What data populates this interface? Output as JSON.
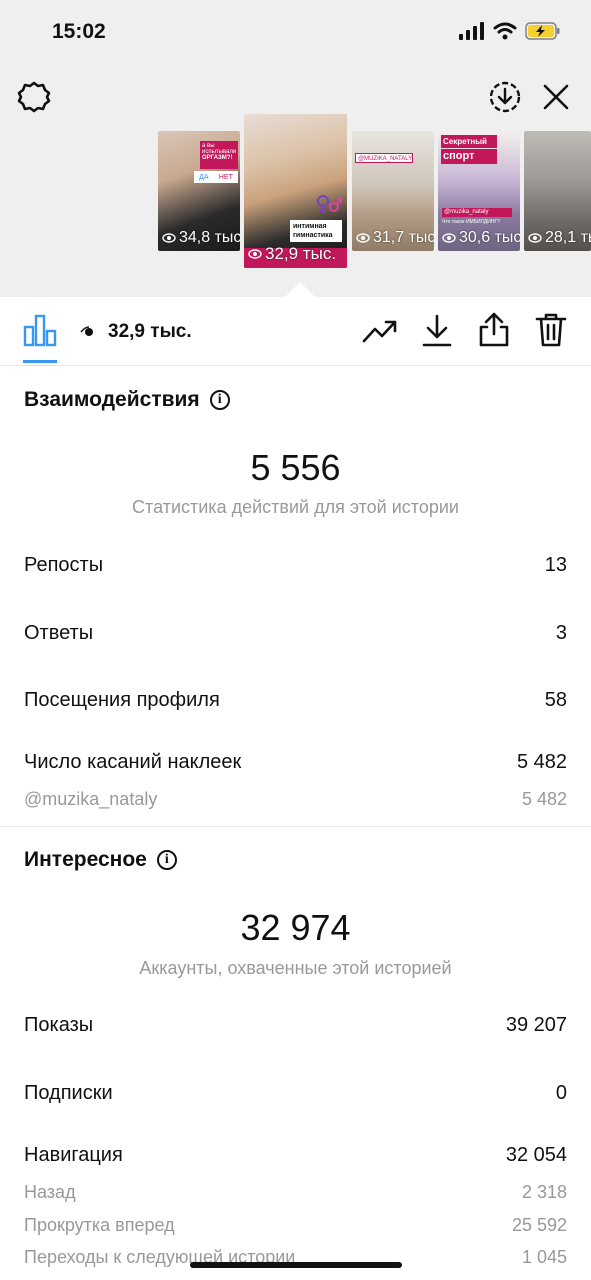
{
  "status_bar": {
    "time": "15:02"
  },
  "stories": [
    {
      "views": "34,8 тыс.",
      "sticker_lines": [
        "а вы испытывали",
        "ОРГАЗМ?!"
      ],
      "poll_options": [
        "ДА",
        "НЕТ"
      ]
    },
    {
      "views": "32,9 тыс.",
      "sticker_lines": [
        "интимная",
        "гимнастика"
      ],
      "selected": true
    },
    {
      "views": "31,7 тыс.",
      "sticker_lines": [
        "@MUZIKA_NATALY"
      ]
    },
    {
      "views": "30,6 тыс.",
      "sticker_lines": [
        "Секретный",
        "спорт",
        "@muzika_nataly",
        "Что такое ИМБИЛДИНГ?"
      ]
    },
    {
      "views": "28,1 тыс."
    }
  ],
  "toolbar": {
    "views": "32,9 тыс."
  },
  "interactions": {
    "title": "Взаимодействия",
    "total": "5 556",
    "subtitle": "Статистика действий для этой истории",
    "rows": [
      {
        "label": "Репосты",
        "value": "13"
      },
      {
        "label": "Ответы",
        "value": "3"
      },
      {
        "label": "Посещения профиля",
        "value": "58"
      },
      {
        "label": "Число касаний наклеек",
        "value": "5 482"
      }
    ],
    "sticker_sub": {
      "label": "@muzika_nataly",
      "value": "5 482"
    }
  },
  "discovery": {
    "title": "Интересное",
    "total": "32 974",
    "subtitle": "Аккаунты, охваченные этой историей",
    "rows": [
      {
        "label": "Показы",
        "value": "39 207"
      },
      {
        "label": "Подписки",
        "value": "0"
      },
      {
        "label": "Навигация",
        "value": "32 054"
      }
    ],
    "navigation_sub": [
      {
        "label": "Назад",
        "value": "2 318"
      },
      {
        "label": "Прокрутка вперед",
        "value": "25 592"
      },
      {
        "label": "Переходы к следующей истории",
        "value": "1 045"
      }
    ]
  },
  "colors": {
    "accent": "#3897f0",
    "muted": "#999999",
    "top_bg": "#efefef",
    "battery": "#f5d12d"
  }
}
